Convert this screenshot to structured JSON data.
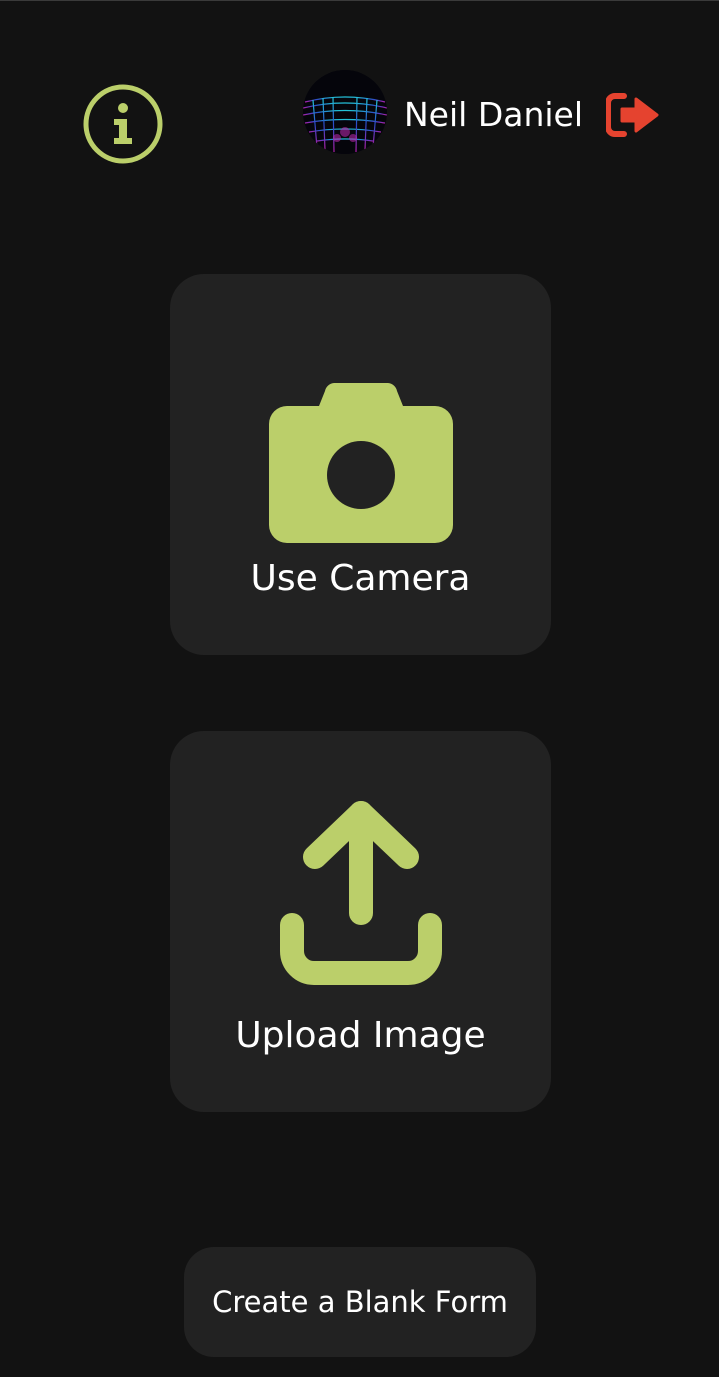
{
  "header": {
    "info_icon": "info-icon",
    "avatar_icon": "hexagon-grid-avatar",
    "user_name": "Neil Daniel",
    "logout_icon": "sign-out-icon"
  },
  "actions": [
    {
      "label": "Use Camera",
      "icon": "camera-icon"
    },
    {
      "label": "Upload Image",
      "icon": "upload-icon"
    }
  ],
  "footer": {
    "blank_form_label": "Create a Blank Form"
  },
  "colors": {
    "background": "#121212",
    "card": "#222222",
    "accent": "#BBCF6A",
    "logout": "#E5432F",
    "text": "#FFFFFF"
  }
}
